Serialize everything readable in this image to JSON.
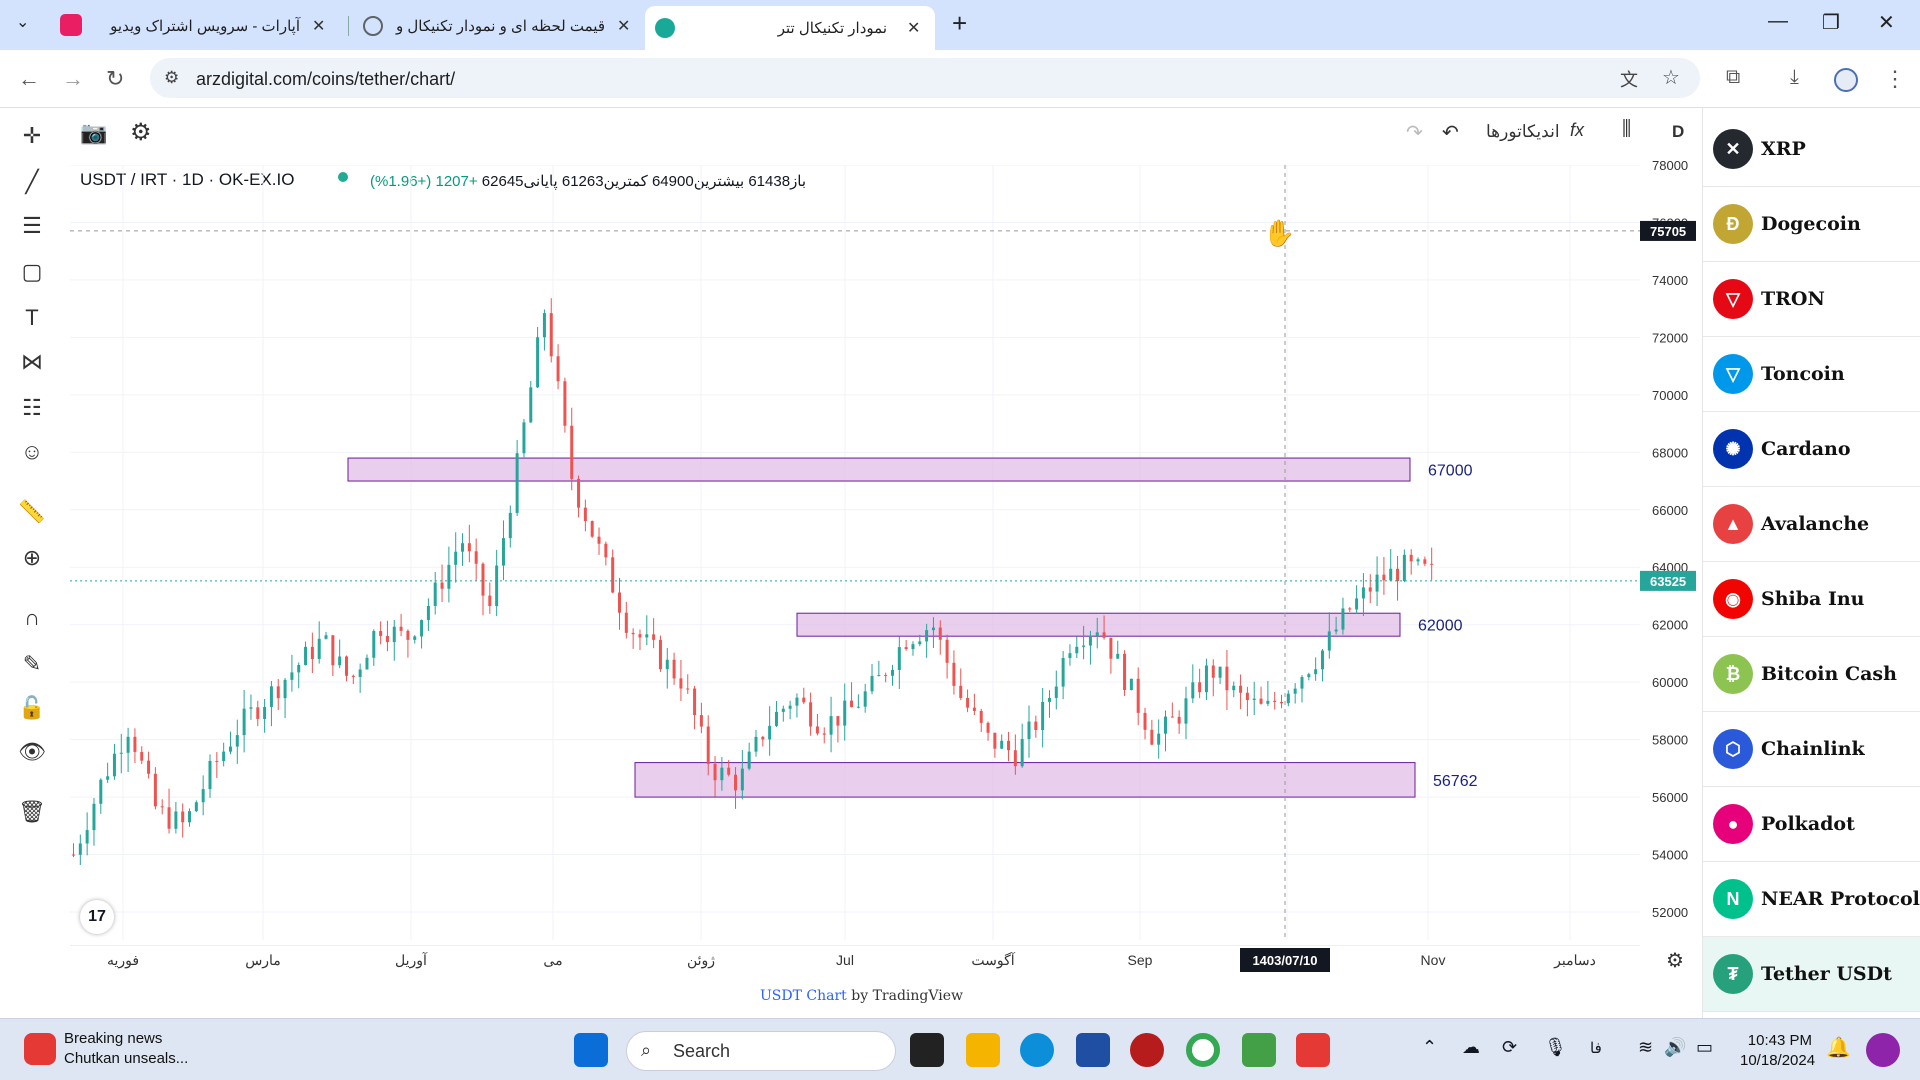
{
  "browser": {
    "tabs": [
      {
        "title": "آپارات - سرویس اشتراک ویدیو",
        "fav_color": "#ea1d5d",
        "active": false
      },
      {
        "title": "قیمت لحظه ای و نمودار تکنیکال و",
        "fav_color": "#5f6368",
        "active": false
      },
      {
        "title": "نمودار تکنیکال تتر",
        "fav_color": "#18a999",
        "active": true
      }
    ],
    "new_tab": "+",
    "url": "arzdigital.com/coins/tether/chart/",
    "window_controls": {
      "min": "—",
      "max": "❐",
      "close": "✕"
    }
  },
  "toolbar": {
    "interval": "D",
    "indicators_label": "اندیکاتورها",
    "fx": "fx"
  },
  "chart_header": {
    "symbol": "USDT / IRT · 1D · OK-EX.IO",
    "ohlc_text": "باز61438 بیشترین64900 کمترین61263 پایانی62645",
    "change": "+1207 (+1.96%)"
  },
  "price_axis": {
    "ticks": [
      "78000",
      "76000",
      "74000",
      "72000",
      "70000",
      "68000",
      "66000",
      "64000",
      "62000",
      "60000",
      "58000",
      "56000",
      "54000",
      "52000"
    ],
    "crosshair_price": "75705",
    "last_price": "63525"
  },
  "time_axis": {
    "labels": [
      "فوریه",
      "مارس",
      "آوریل",
      "می",
      "ژوئن",
      "Jul",
      "آگوست",
      "Sep",
      "Nov",
      "دسامبر"
    ],
    "crosshair_date": "1403/07/10"
  },
  "chart_data": {
    "type": "candlestick",
    "title": "USDT / IRT · 1D · OK-EX.IO",
    "ylim": [
      51000,
      79000
    ],
    "zones": [
      {
        "label": "67000",
        "low": 67000,
        "high": 67800
      },
      {
        "label": "62000",
        "low": 61600,
        "high": 62400
      },
      {
        "label": "56762",
        "low": 56000,
        "high": 57200
      }
    ],
    "approx_closes": [
      54000,
      56500,
      58500,
      55500,
      55000,
      57000,
      58500,
      59500,
      60500,
      61500,
      60000,
      62000,
      61500,
      63000,
      65000,
      62500,
      67500,
      73000,
      67000,
      64500,
      62000,
      61000,
      60000,
      57000,
      56500,
      58500,
      59500,
      58500,
      59000,
      60000,
      61500,
      62000,
      59500,
      58000,
      57500,
      59000,
      61500,
      62000,
      60000,
      58000,
      59000,
      60500,
      59500,
      59000,
      60000,
      61000,
      62500,
      63500,
      64000,
      63800
    ]
  },
  "right_panel": {
    "coins": [
      {
        "name": "XRP",
        "color": "#23292f",
        "glyph": "✕"
      },
      {
        "name": "Dogecoin",
        "color": "#c2a633",
        "glyph": "Ð"
      },
      {
        "name": "TRON",
        "color": "#e50915",
        "glyph": "▽"
      },
      {
        "name": "Toncoin",
        "color": "#0098ea",
        "glyph": "▽"
      },
      {
        "name": "Cardano",
        "color": "#0033ad",
        "glyph": "✺"
      },
      {
        "name": "Avalanche",
        "color": "#e84142",
        "glyph": "▲"
      },
      {
        "name": "Shiba Inu",
        "color": "#f00500",
        "glyph": "◉"
      },
      {
        "name": "Bitcoin Cash",
        "color": "#8dc351",
        "glyph": "₿"
      },
      {
        "name": "Chainlink",
        "color": "#2a5ada",
        "glyph": "⬡"
      },
      {
        "name": "Polkadot",
        "color": "#e6007a",
        "glyph": "●"
      },
      {
        "name": "NEAR Protocol",
        "color": "#00c08b",
        "glyph": "N"
      },
      {
        "name": "Tether USDt",
        "color": "#26a17b",
        "glyph": "₮"
      }
    ]
  },
  "credit": {
    "link": "USDT Chart",
    "rest": " by TradingView"
  },
  "taskbar": {
    "news_title": "Breaking news",
    "news_sub": "Chutkan unseals...",
    "search": "Search",
    "lang": "فا",
    "time": "10:43 PM",
    "date": "10/18/2024"
  }
}
